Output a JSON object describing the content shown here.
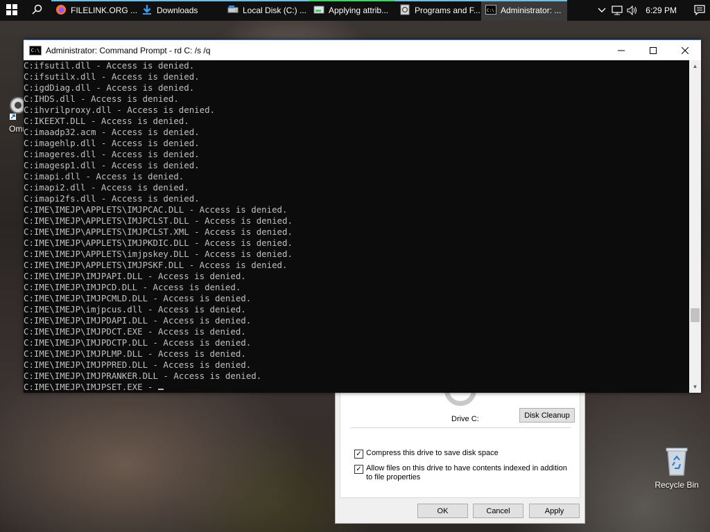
{
  "taskbar": {
    "apps": [
      {
        "label": "FILELINK.ORG ...",
        "icon": "firefox-icon"
      },
      {
        "label": "Downloads",
        "icon": "download-folder-icon"
      },
      {
        "label": "Local Disk (C:) ...",
        "icon": "drive-icon"
      },
      {
        "label": "Applying attrib...",
        "icon": "file-progress-icon"
      },
      {
        "label": "Programs and F...",
        "icon": "control-panel-icon"
      },
      {
        "label": "Administrator: ...",
        "icon": "cmd-icon"
      }
    ],
    "clock": "6:29 PM"
  },
  "desktop": {
    "icons": [
      {
        "label": "Omn"
      },
      {
        "label": "Recycle Bin"
      }
    ]
  },
  "cmd": {
    "title": "Administrator: Command Prompt - rd  C: /s /q",
    "lines": [
      "C:ifsutil.dll - Access is denied.",
      "C:ifsutilx.dll - Access is denied.",
      "C:igdDiag.dll - Access is denied.",
      "C:IHDS.dll - Access is denied.",
      "C:ihvrilproxy.dll - Access is denied.",
      "C:IKEEXT.DLL - Access is denied.",
      "C:imaadp32.acm - Access is denied.",
      "C:imagehlp.dll - Access is denied.",
      "C:imageres.dll - Access is denied.",
      "C:imagesp1.dll - Access is denied.",
      "C:imapi.dll - Access is denied.",
      "C:imapi2.dll - Access is denied.",
      "C:imapi2fs.dll - Access is denied.",
      "C:IME\\IMEJP\\APPLETS\\IMJPCAC.DLL - Access is denied.",
      "C:IME\\IMEJP\\APPLETS\\IMJPCLST.DLL - Access is denied.",
      "C:IME\\IMEJP\\APPLETS\\IMJPCLST.XML - Access is denied.",
      "C:IME\\IMEJP\\APPLETS\\IMJPKDIC.DLL - Access is denied.",
      "C:IME\\IMEJP\\APPLETS\\imjpskey.DLL - Access is denied.",
      "C:IME\\IMEJP\\APPLETS\\IMJPSKF.DLL - Access is denied.",
      "C:IME\\IMEJP\\IMJPAPI.DLL - Access is denied.",
      "C:IME\\IMEJP\\IMJPCD.DLL - Access is denied.",
      "C:IME\\IMEJP\\IMJPCMLD.DLL - Access is denied.",
      "C:IME\\IMEJP\\imjpcus.dll - Access is denied.",
      "C:IME\\IMEJP\\IMJPDAPI.DLL - Access is denied.",
      "C:IME\\IMEJP\\IMJPDCT.EXE - Access is denied.",
      "C:IME\\IMEJP\\IMJPDCTP.DLL - Access is denied.",
      "C:IME\\IMEJP\\IMJPLMP.DLL - Access is denied.",
      "C:IME\\IMEJP\\IMJPPRED.DLL - Access is denied.",
      "C:IME\\IMEJP\\IMJPRANKER.DLL - Access is denied.",
      "C:IME\\IMEJP\\IMJPSET.EXE - "
    ]
  },
  "properties": {
    "drive_label": "Drive C:",
    "disk_cleanup_label": "Disk Cleanup",
    "compress_label": "Compress this drive to save disk space",
    "compress_checked": true,
    "index_label": "Allow files on this drive to have contents indexed in addition to file properties",
    "index_checked": true,
    "ok_label": "OK",
    "cancel_label": "Cancel",
    "apply_label": "Apply"
  },
  "colors": {
    "taskbar_bg": "#101010",
    "accent": "#6fbfe8",
    "console_bg": "#0c0c0c",
    "console_fg": "#c0c0c0"
  }
}
